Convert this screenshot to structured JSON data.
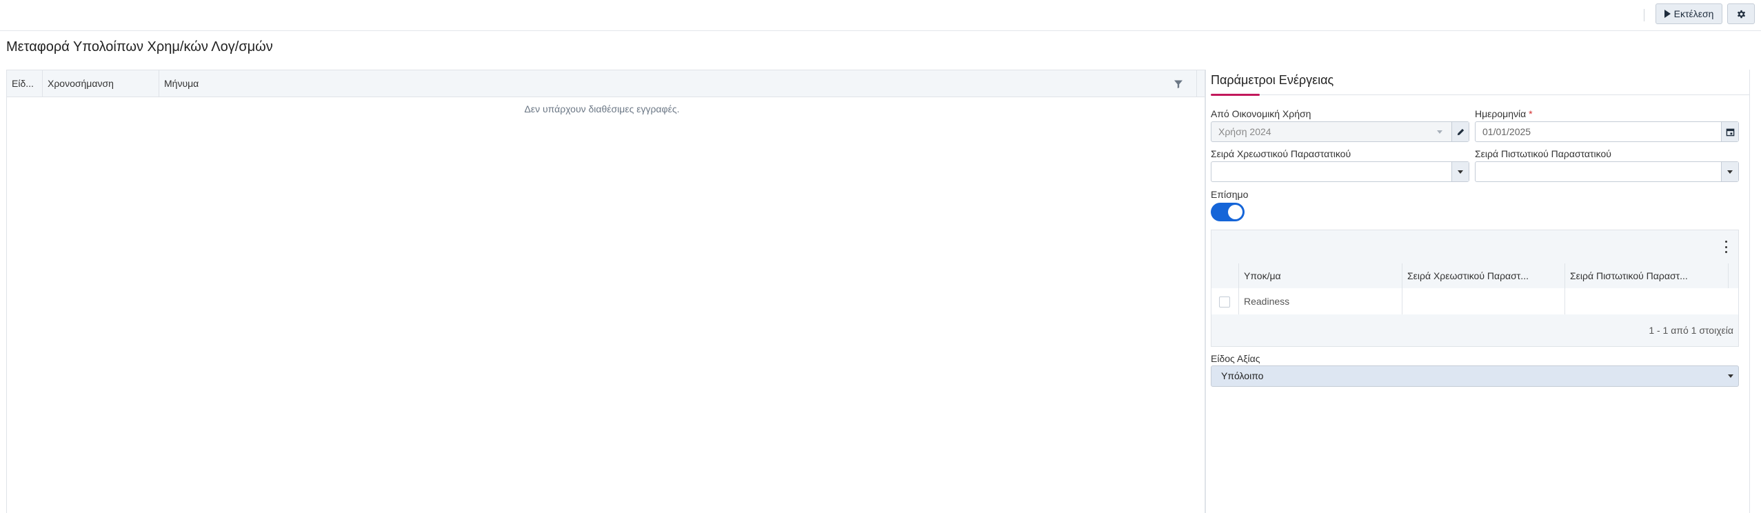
{
  "toolbar": {
    "run_label": "Εκτέλεση",
    "run_icon": "play-icon",
    "settings_icon": "gear-icon"
  },
  "page": {
    "title": "Μεταφορά Υπολοίπων Χρημ/κών Λογ/σμών"
  },
  "log_grid": {
    "columns": [
      "Είδ...",
      "Χρονοσήμανση",
      "Μήνυμα"
    ],
    "empty_message": "Δεν υπάρχουν διαθέσιμες εγγραφές.",
    "filter_icon": "filter-icon"
  },
  "params": {
    "title": "Παράμετροι Ενέργειας",
    "from_year": {
      "label": "Από Οικονομική Χρήση",
      "value": "Χρήση 2024",
      "disabled": true
    },
    "date": {
      "label": "Ημερομηνία",
      "required_mark": "*",
      "value": "01/01/2025"
    },
    "debit_series": {
      "label": "Σειρά Χρεωστικού Παραστατικού",
      "value": ""
    },
    "credit_series": {
      "label": "Σειρά Πιστωτικού Παραστατικού",
      "value": ""
    },
    "official": {
      "label": "Επίσημο",
      "on": true
    },
    "subgrid": {
      "columns": [
        "Υποκ/μα",
        "Σειρά Χρεωστικού Παραστ...",
        "Σειρά Πιστωτικού Παραστ..."
      ],
      "rows": [
        {
          "branch": "Readiness",
          "debit": "",
          "credit": ""
        }
      ],
      "pager": "1 - 1 από 1 στοιχεία"
    },
    "value_type": {
      "label": "Είδος Αξίας",
      "value": "Υπόλοιπο"
    }
  },
  "colors": {
    "accent": "#c2185b",
    "toggle_on": "#1565d8",
    "header_bg": "#f3f6f9"
  }
}
